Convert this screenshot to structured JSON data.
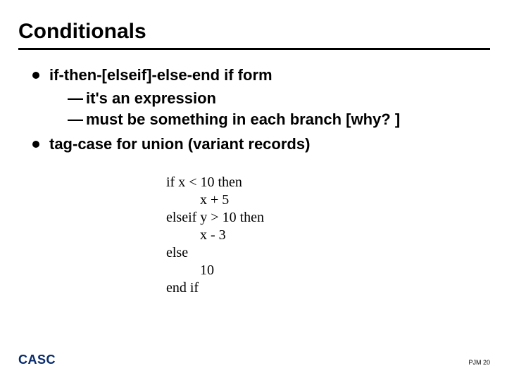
{
  "title": "Conditionals",
  "bullets": [
    {
      "text": "if-then-[elseif]-else-end if form",
      "subs": [
        "it's an expression",
        "must be something in each branch [why? ]"
      ]
    },
    {
      "text": "tag-case for union (variant records)",
      "subs": []
    }
  ],
  "code": [
    {
      "text": "if x < 10 then",
      "indent": false
    },
    {
      "text": "x + 5",
      "indent": true
    },
    {
      "text": "elseif y > 10 then",
      "indent": false
    },
    {
      "text": "x - 3",
      "indent": true
    },
    {
      "text": "else",
      "indent": false
    },
    {
      "text": "10",
      "indent": true
    },
    {
      "text": "end if",
      "indent": false
    }
  ],
  "footer": {
    "left": "CASC",
    "right_prefix": "PJM",
    "page": "20"
  }
}
